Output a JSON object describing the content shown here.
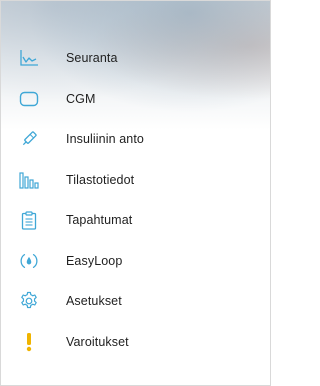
{
  "menu": {
    "items": [
      {
        "label": "Seuranta",
        "icon": "monitoring-chart-icon"
      },
      {
        "label": "CGM",
        "icon": "cgm-device-icon"
      },
      {
        "label": "Insuliinin anto",
        "icon": "insulin-pen-icon"
      },
      {
        "label": "Tilastotiedot",
        "icon": "statistics-bars-icon"
      },
      {
        "label": "Tapahtumat",
        "icon": "events-clipboard-icon"
      },
      {
        "label": "EasyLoop",
        "icon": "easyloop-drop-icon"
      },
      {
        "label": "Asetukset",
        "icon": "settings-gear-icon"
      },
      {
        "label": "Varoitukset",
        "icon": "warning-exclamation-icon"
      }
    ]
  },
  "colors": {
    "accent": "#3fa7d6",
    "warning": "#f0b400",
    "text": "#1f1f1f"
  }
}
